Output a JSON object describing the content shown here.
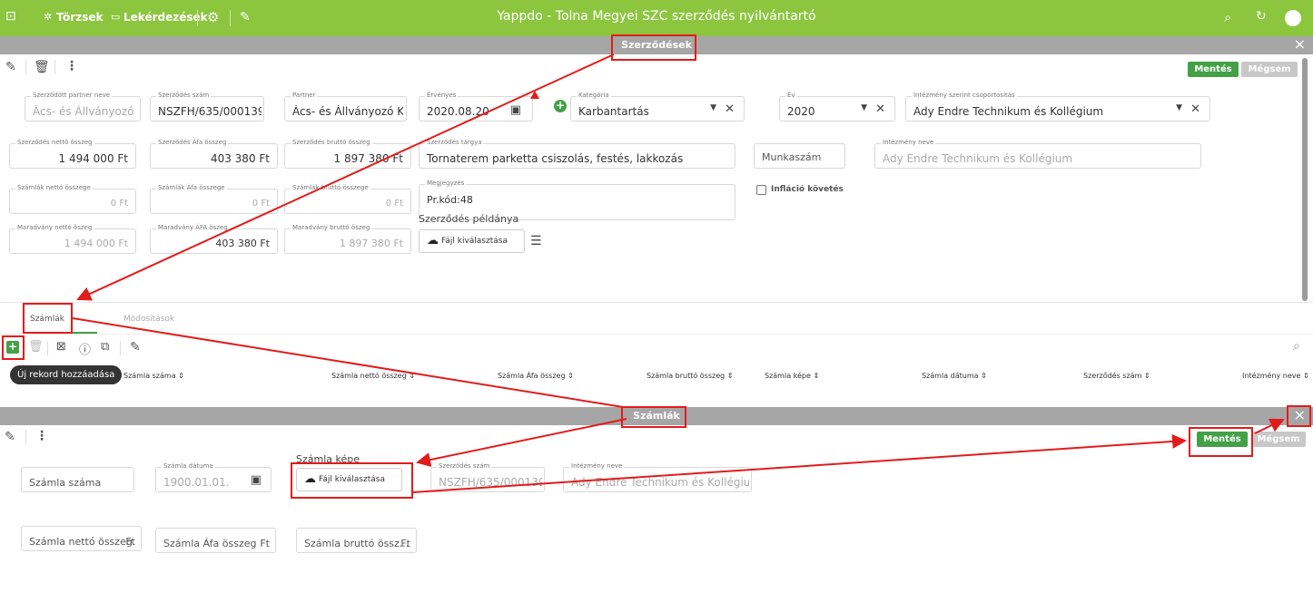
{
  "app": {
    "title": "Yappdo - Tolna Megyei SZC szerződés nyilvántartó"
  },
  "nav": {
    "torzsek": "Törzsek",
    "lekerdezesek": "Lekérdezések"
  },
  "icons": {
    "apps": "apps-icon",
    "search": "search-icon",
    "refresh": "refresh-icon",
    "user": "user-avatar-icon",
    "settings": "gear-icon",
    "wrench": "wrench-icon"
  },
  "colors": {
    "accent": "#8cc63f",
    "button": "#43a047",
    "annotation": "#e31b1b"
  },
  "contract": {
    "title": "Szerződések",
    "save": "Mentés",
    "cancel": "Mégsem",
    "partner_name_label": "Szerződött partner neve",
    "partner_name": "Ács- és Állványozó K",
    "contract_no_label": "Szerződés szám",
    "contract_no": "NSZFH/635/000139-",
    "partner_label": "Partner",
    "partner": "Ács- és Állványozó K·",
    "valid_label": "Érvényes",
    "valid": "2020.08.20",
    "category_label": "Kategória",
    "category": "Karbantartás",
    "year_label": "Év",
    "year": "2020",
    "group_label": "Intézmény szerint csoportosítás",
    "group": "Ady Endre Technikum és Kollégium",
    "net_label": "Szerződés nettó összeg",
    "net": "1 494 000 Ft",
    "vat_label": "Szerződés Áfa összeg",
    "vat": "403 380 Ft",
    "gross_label": "Szerződés bruttó összeg",
    "gross": "1 897 380 Ft",
    "subject_label": "Szerződés tárgya",
    "subject": "Tornaterem parketta csiszolás, festés, lakkozás",
    "worknum_placeholder": "Munkaszám",
    "institution_label": "Intézmény neve",
    "institution": "Ady Endre Technikum és Kollégium",
    "inv_net_label": "Számlák nettó összege",
    "inv_net": "0 Ft",
    "inv_vat_label": "Számlák Áfa összege",
    "inv_vat": "0 Ft",
    "inv_gross_label": "Számlák bruttó összege",
    "inv_gross": "0 Ft",
    "note_label": "Megjegyzés",
    "note": "Pr.kód:48",
    "inflation": "Infláció követés",
    "copy_label": "Szerződés példánya",
    "file_button": "Fájl kiválasztása",
    "rem_net_label": "Maradvány nettó öszeg",
    "rem_net": "1 494 000 Ft",
    "rem_vat_label": "Maradvány ÁFA öszeg",
    "rem_vat": "403 380 Ft",
    "rem_gross_label": "Maradvány bruttó öszeg",
    "rem_gross": "1 897 380 Ft"
  },
  "tabs": {
    "invoices": "Számlák",
    "modifications": "Módosítások"
  },
  "tooltip": "Új rekord hozzáadása",
  "columns": [
    "Számla száma ⇕",
    "Számla nettó összeg ⇕",
    "Számla Áfa összeg ⇕",
    "Számla bruttó összeg ⇕",
    "Számla képe ⇕",
    "Számla dátuma ⇕",
    "Szerződés szám ⇕",
    "Intézmény neve ⇕"
  ],
  "invoice": {
    "title": "Számlák",
    "save": "Mentés",
    "cancel": "Mégsem",
    "number_placeholder": "Számla száma",
    "date_label": "Számla dátuma",
    "date": "1900.01.01.",
    "image_label": "Számla képe",
    "file_button": "Fájl kiválasztása",
    "contract_no_label": "Szerződés szám",
    "contract_no": "NSZFH/635/000139-",
    "institution_label": "Intézmény neve",
    "institution": "Ady Endre Technikum és Kollégium",
    "net_placeholder": "Számla nettó összeg",
    "vat_placeholder": "Számla Áfa összeg",
    "gross_placeholder": "Számla bruttó össz...",
    "currency": "Ft"
  }
}
